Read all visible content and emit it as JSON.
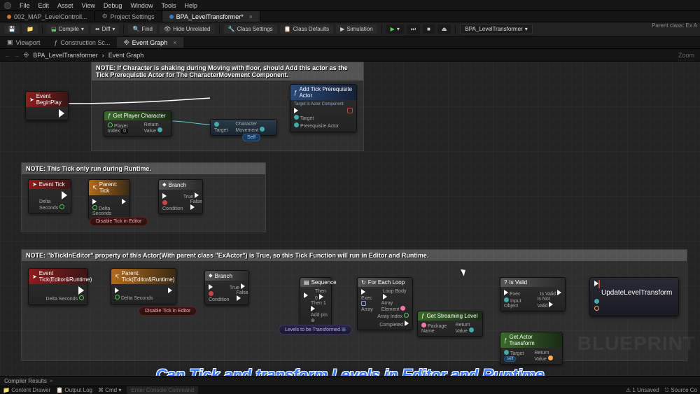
{
  "menu": {
    "items": [
      "File",
      "Edit",
      "Asset",
      "View",
      "Debug",
      "Window",
      "Tools",
      "Help"
    ]
  },
  "parent_class_label": "Parent class: Ex A",
  "main_tabs": [
    {
      "label": "002_MAP_LevelControll...",
      "active": false,
      "dot": "orange"
    },
    {
      "label": "Project Settings",
      "active": false,
      "dot": "gear"
    },
    {
      "label": "BPA_LevelTransformer*",
      "active": true,
      "dot": "blue"
    }
  ],
  "toolbar": {
    "save": "",
    "compile": "Compile",
    "diff": "Diff",
    "find": "Find",
    "hide": "Hide Unrelated",
    "class_settings": "Class Settings",
    "class_defaults": "Class Defaults",
    "simulation": "Simulation",
    "debug_target": "BPA_LevelTransformer"
  },
  "sub_tabs": [
    {
      "label": "Viewport",
      "active": false
    },
    {
      "label": "Construction Sc...",
      "active": false
    },
    {
      "label": "Event Graph",
      "active": true
    }
  ],
  "breadcrumb": {
    "root": "BPA_LevelTransformer",
    "leaf": "Event Graph",
    "zoom": "Zoom"
  },
  "comments": {
    "c1": "NOTE: If Character is shaking during Moving with floor, should Add this actor as the Tick Prerequistie Actor for The CharacterMovement Component.",
    "c2": "NOTE: This Tick only run during Runtime.",
    "c3": "NOTE: \"bTickInEditor\" property of this Actor(With parent class \"ExActor\") is True, so this Tick Function will run in Editor and Runtime."
  },
  "nodes": {
    "beginplay": {
      "title": "Event BeginPlay"
    },
    "getplayer": {
      "title": "Get Player Character",
      "player_index": "Player Index",
      "zero": "0",
      "return": "Return Value"
    },
    "charmove": {
      "target": "Target",
      "label": "Character Movement"
    },
    "addtick": {
      "title": "Add Tick Prerequisite Actor",
      "sub": "Target is Actor Component",
      "target": "Target",
      "prereq": "Prerequisite Actor"
    },
    "self": "Self",
    "eventtick1": {
      "title": "Event Tick",
      "ds": "Delta Seconds"
    },
    "parenttick1": {
      "title": "Parent: Tick",
      "ds": "Delta Seconds"
    },
    "branch1": {
      "title": "Branch",
      "cond": "Condition",
      "true": "True",
      "false": "False"
    },
    "disable1": "Disable Tick in Editor",
    "eventtick2": {
      "title": "Event Tick(Editor&Runtime)",
      "ds": "Delta Seconds"
    },
    "parenttick2": {
      "title": "Parent: Tick(Editor&Runtime)",
      "ds": "Delta Seconds"
    },
    "branch2": {
      "title": "Branch",
      "cond": "Condition",
      "true": "True",
      "false": "False"
    },
    "disable2": "Disable Tick in Editor",
    "sequence": {
      "title": "Sequence",
      "then0": "Then 0",
      "then1": "Then 1",
      "addpin": "Add pin"
    },
    "levels_var": "Levels to be Transformed",
    "foreach": {
      "title": "For Each Loop",
      "exec": "Exec",
      "array": "Array",
      "loopbody": "Loop Body",
      "elem": "Array Element",
      "idx": "Array Index",
      "completed": "Completed"
    },
    "getstream": {
      "title": "Get Streaming Level",
      "pkg": "Package Name",
      "return": "Return Value"
    },
    "isvalid": {
      "title": "Is Valid",
      "exec": "Exec",
      "input": "Input Object",
      "valid": "Is Valid",
      "notvalid": "Is Not Valid"
    },
    "getactortrans": {
      "title": "Get Actor Transform",
      "target": "Target",
      "self": "self",
      "return": "Return Value"
    },
    "update": {
      "title": "UpdateLevelTransform"
    }
  },
  "compiler_tab": "Compiler Results",
  "status": {
    "drawer": "Content Drawer",
    "output": "Output Log",
    "cmd": "Cmd",
    "cmdhint": "Enter Console Command",
    "unsaved": "1 Unsaved",
    "source": "Source Co"
  },
  "caption": "Can Tick and transform Levels in Editor and Runtime",
  "watermark": "BLUEPRINT"
}
